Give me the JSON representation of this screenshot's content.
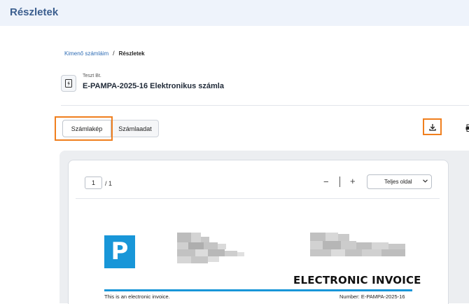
{
  "header": {
    "title": "Részletek"
  },
  "breadcrumb": {
    "parent": "Kimenő számláim",
    "separator": "/",
    "current": "Részletek"
  },
  "invoice": {
    "company": "Teszt Bt.",
    "title": "E-PAMPA-2025-16 Elektronikus számla"
  },
  "tabs": [
    {
      "label": "Számlakép",
      "active": true
    },
    {
      "label": "Számlaadat",
      "active": false
    }
  ],
  "toolbar": {
    "download_icon": "download-icon",
    "print_icon": "printer-icon"
  },
  "viewer": {
    "page_value": "1",
    "page_total": "/ 1",
    "zoom_out": "−",
    "zoom_in": "+",
    "zoom_mode": "Teljes oldal"
  },
  "document": {
    "logo_letter": "P",
    "heading": "ELECTRONIC INVOICE",
    "note": "This is an electronic invoice.",
    "number": "Number: E-PAMPA-2025-16",
    "accent_color": "#1896d8"
  },
  "colors": {
    "highlight": "#f07f1e",
    "header_bg": "#eef3fb",
    "header_text": "#3c5f8f"
  }
}
